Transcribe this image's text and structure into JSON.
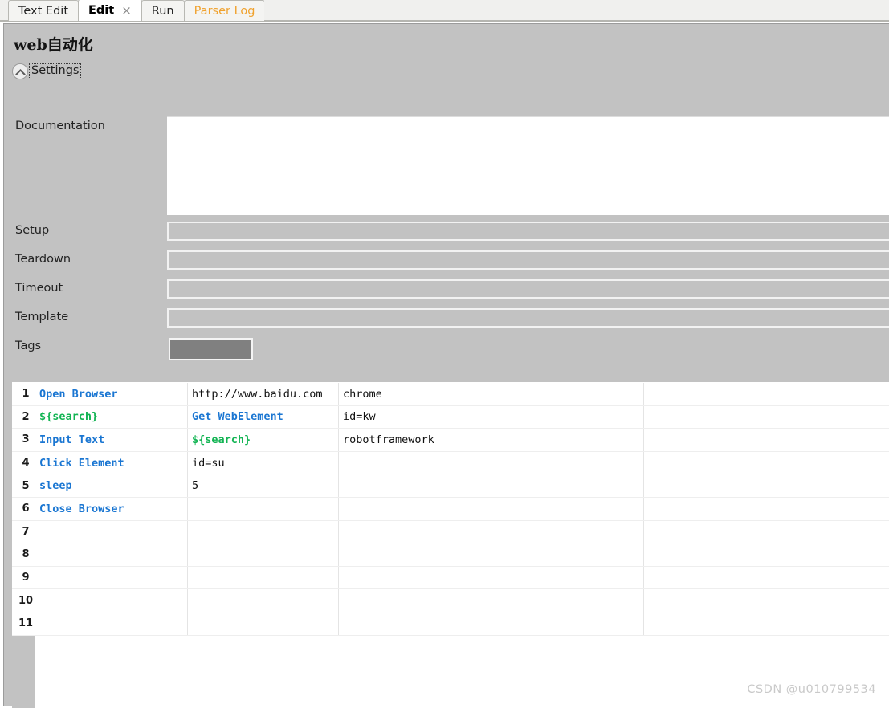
{
  "tabs": [
    {
      "label": "Text Edit",
      "active": false,
      "accent": false,
      "closable": false
    },
    {
      "label": "Edit",
      "active": true,
      "accent": false,
      "closable": true
    },
    {
      "label": "Run",
      "active": false,
      "accent": false,
      "closable": false
    },
    {
      "label": "Parser Log",
      "active": false,
      "accent": true,
      "closable": false
    }
  ],
  "tab_close_glyph": "×",
  "suite": {
    "title": "web自动化",
    "settings_label": "Settings",
    "collapse_icon": "chevron-up-icon"
  },
  "settings_fields": {
    "documentation_label": "Documentation",
    "documentation_value": "",
    "setup_label": "Setup",
    "setup_value": "",
    "teardown_label": "Teardown",
    "teardown_value": "",
    "timeout_label": "Timeout",
    "timeout_value": "",
    "template_label": "Template",
    "template_value": "",
    "tags_label": "Tags",
    "tags_value": ""
  },
  "colors": {
    "panel_bg": "#C2C2C2",
    "keyword_blue": "#1A76D2",
    "variable_green": "#12B453",
    "tab_accent_orange": "#F0A22E",
    "cell_gray": "#C0C0C0",
    "cell_light": "#F4F4F4",
    "tags_fill": "#808080"
  },
  "grid": {
    "row_count": 11,
    "col_count": 6,
    "rows": [
      {
        "num": "1",
        "cells": [
          {
            "text": "Open Browser",
            "style": "kw",
            "bg": "light"
          },
          {
            "text": "http://www.baidu.com",
            "style": "plain",
            "bg": "light"
          },
          {
            "text": "chrome",
            "style": "plain",
            "bg": "light"
          },
          {
            "text": "",
            "style": "plain",
            "bg": "light"
          },
          {
            "text": "",
            "style": "plain",
            "bg": "light"
          },
          {
            "text": "",
            "style": "plain",
            "bg": "light"
          }
        ]
      },
      {
        "num": "2",
        "cells": [
          {
            "text": "${search}",
            "style": "var",
            "bg": "white"
          },
          {
            "text": "Get WebElement",
            "style": "kw",
            "bg": "white"
          },
          {
            "text": "id=kw",
            "style": "plain",
            "bg": "white"
          },
          {
            "text": "",
            "style": "plain",
            "bg": "gray"
          },
          {
            "text": "",
            "style": "plain",
            "bg": "gray"
          },
          {
            "text": "",
            "style": "plain",
            "bg": "gray"
          }
        ]
      },
      {
        "num": "3",
        "cells": [
          {
            "text": "Input Text",
            "style": "kw",
            "bg": "light"
          },
          {
            "text": "${search}",
            "style": "var",
            "bg": "white"
          },
          {
            "text": "robotframework",
            "style": "plain",
            "bg": "white"
          },
          {
            "text": "",
            "style": "plain",
            "bg": "light"
          },
          {
            "text": "",
            "style": "plain",
            "bg": "gray"
          },
          {
            "text": "",
            "style": "plain",
            "bg": "gray"
          }
        ]
      },
      {
        "num": "4",
        "cells": [
          {
            "text": "Click Element",
            "style": "kw",
            "bg": "white"
          },
          {
            "text": "id=su",
            "style": "plain",
            "bg": "light"
          },
          {
            "text": "",
            "style": "plain",
            "bg": "light"
          },
          {
            "text": "",
            "style": "plain",
            "bg": "light"
          },
          {
            "text": "",
            "style": "plain",
            "bg": "gray"
          },
          {
            "text": "",
            "style": "plain",
            "bg": "gray"
          }
        ]
      },
      {
        "num": "5",
        "cells": [
          {
            "text": "sleep",
            "style": "kw",
            "bg": "light"
          },
          {
            "text": "5",
            "style": "plain",
            "bg": "light"
          },
          {
            "text": "",
            "style": "plain",
            "bg": "light"
          },
          {
            "text": "",
            "style": "plain",
            "bg": "gray"
          },
          {
            "text": "",
            "style": "plain",
            "bg": "gray"
          },
          {
            "text": "",
            "style": "plain",
            "bg": "gray"
          }
        ]
      },
      {
        "num": "6",
        "cells": [
          {
            "text": "Close Browser",
            "style": "kw",
            "bg": "white"
          },
          {
            "text": "",
            "style": "plain",
            "bg": "gray"
          },
          {
            "text": "",
            "style": "plain",
            "bg": "gray"
          },
          {
            "text": "",
            "style": "plain",
            "bg": "gray"
          },
          {
            "text": "",
            "style": "plain",
            "bg": "gray"
          },
          {
            "text": "",
            "style": "plain",
            "bg": "gray"
          }
        ]
      },
      {
        "num": "7",
        "cells": [
          {
            "text": "",
            "style": "plain",
            "bg": "white"
          },
          {
            "text": "",
            "style": "plain",
            "bg": "white"
          },
          {
            "text": "",
            "style": "plain",
            "bg": "white"
          },
          {
            "text": "",
            "style": "plain",
            "bg": "white"
          },
          {
            "text": "",
            "style": "plain",
            "bg": "white"
          },
          {
            "text": "",
            "style": "plain",
            "bg": "white"
          }
        ]
      },
      {
        "num": "8",
        "cells": [
          {
            "text": "",
            "style": "plain",
            "bg": "white"
          },
          {
            "text": "",
            "style": "plain",
            "bg": "white"
          },
          {
            "text": "",
            "style": "plain",
            "bg": "white"
          },
          {
            "text": "",
            "style": "plain",
            "bg": "white"
          },
          {
            "text": "",
            "style": "plain",
            "bg": "white"
          },
          {
            "text": "",
            "style": "plain",
            "bg": "white"
          }
        ]
      },
      {
        "num": "9",
        "cells": [
          {
            "text": "",
            "style": "plain",
            "bg": "white"
          },
          {
            "text": "",
            "style": "plain",
            "bg": "white"
          },
          {
            "text": "",
            "style": "plain",
            "bg": "white"
          },
          {
            "text": "",
            "style": "plain",
            "bg": "white"
          },
          {
            "text": "",
            "style": "plain",
            "bg": "white"
          },
          {
            "text": "",
            "style": "plain",
            "bg": "white"
          }
        ]
      },
      {
        "num": "10",
        "cells": [
          {
            "text": "",
            "style": "plain",
            "bg": "white"
          },
          {
            "text": "",
            "style": "plain",
            "bg": "white"
          },
          {
            "text": "",
            "style": "plain",
            "bg": "white"
          },
          {
            "text": "",
            "style": "plain",
            "bg": "white"
          },
          {
            "text": "",
            "style": "plain",
            "bg": "white"
          },
          {
            "text": "",
            "style": "plain",
            "bg": "white"
          }
        ]
      },
      {
        "num": "11",
        "cells": [
          {
            "text": "",
            "style": "plain",
            "bg": "white"
          },
          {
            "text": "",
            "style": "plain",
            "bg": "white"
          },
          {
            "text": "",
            "style": "plain",
            "bg": "white"
          },
          {
            "text": "",
            "style": "plain",
            "bg": "white"
          },
          {
            "text": "",
            "style": "plain",
            "bg": "white"
          },
          {
            "text": "",
            "style": "plain",
            "bg": "white"
          }
        ]
      }
    ]
  },
  "watermark": "CSDN @u010799534"
}
